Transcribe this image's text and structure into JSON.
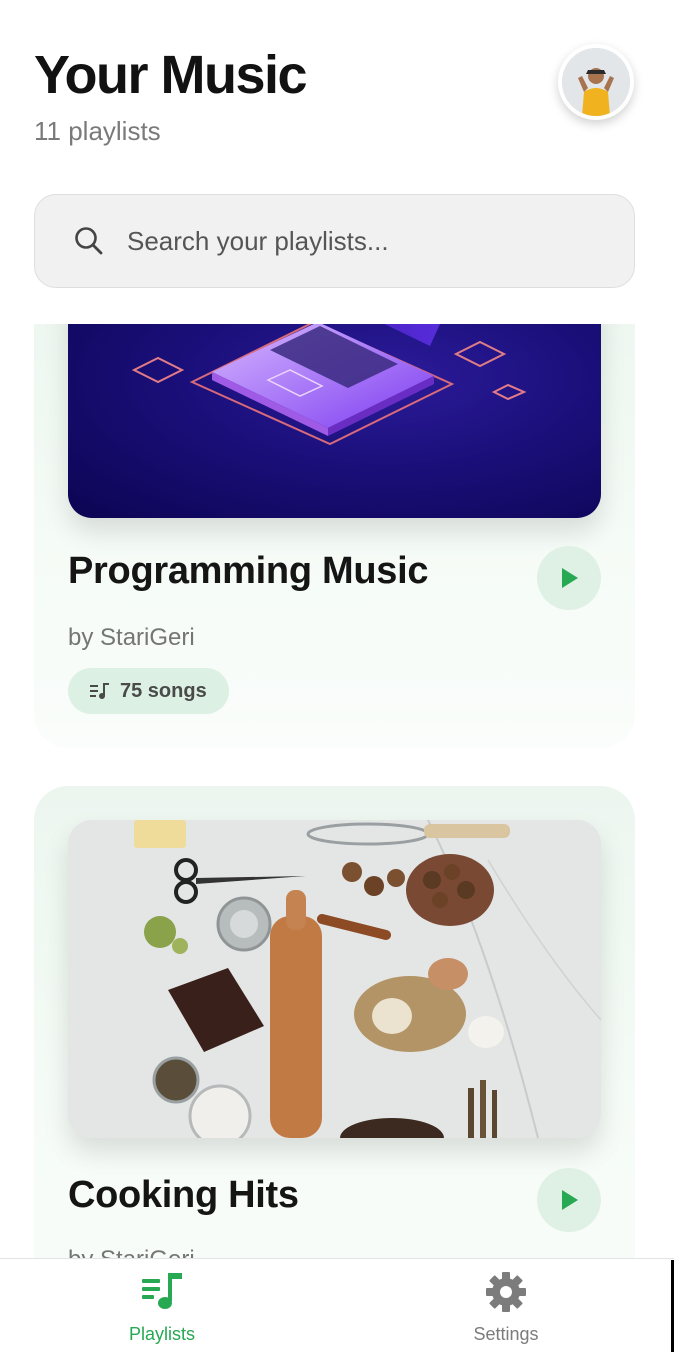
{
  "header": {
    "title": "Your Music",
    "subtitle": "11 playlists"
  },
  "search": {
    "placeholder": "Search your playlists..."
  },
  "playlists": [
    {
      "title": "Programming Music",
      "author": "by StariGeri",
      "songs": "75 songs"
    },
    {
      "title": "Cooking Hits",
      "author": "by StariGeri"
    }
  ],
  "nav": {
    "items": [
      {
        "label": "Playlists",
        "icon": "playlist-music-icon",
        "active": true
      },
      {
        "label": "Settings",
        "icon": "gear-icon",
        "active": false
      }
    ]
  },
  "colors": {
    "accent": "#27a852",
    "card_bg": "#ecf6ef",
    "badge_bg": "#dcf1e3"
  }
}
